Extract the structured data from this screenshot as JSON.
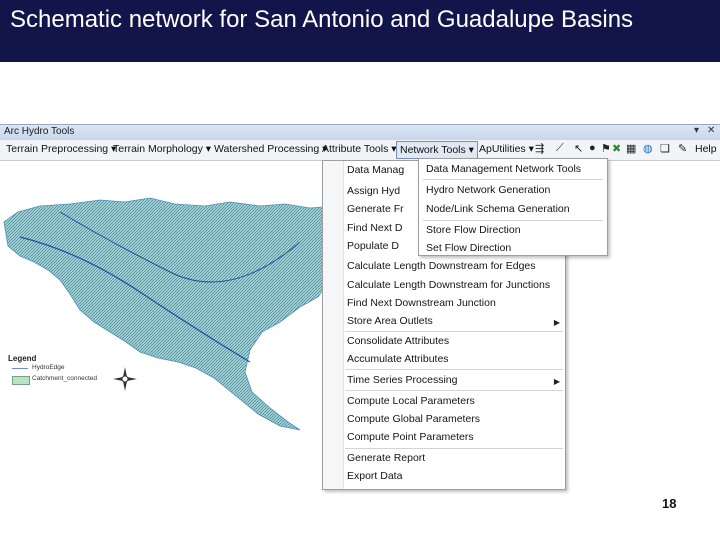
{
  "slide": {
    "title": "Schematic network for San Antonio and Guadalupe Basins",
    "page_number": "18",
    "colors": {
      "title_bar": "#12154a",
      "title_text": "#ffffff",
      "catchment_fill": "#a8d6c8",
      "stream_lines": "#2f6fb0"
    }
  },
  "toolbar": {
    "title": "Arc Hydro Tools",
    "window_controls": [
      "▾",
      "✕"
    ],
    "menus": [
      "Terrain Preprocessing ▾",
      "Terrain Morphology ▾",
      "Watershed Processing ▾",
      "Attribute Tools ▾",
      "Network Tools ▾",
      "ApUtilities ▾"
    ],
    "help_label": "Help",
    "icons": [
      "flow-icon",
      "wand-icon",
      "pointer-icon",
      "dot-icon",
      "flag-icon",
      "cross-icon",
      "grid-icon",
      "globe-icon",
      "layers-icon",
      "pencil-icon"
    ]
  },
  "attribute_menu": {
    "items_truncated": [
      "Data Manag",
      "Assign Hyd",
      "Generate Fr",
      "Find Next D",
      "Populate D"
    ],
    "items": [
      "Calculate Length Downstream for Edges",
      "Calculate Length Downstream for Junctions",
      "Find Next Downstream Junction",
      "Store Area Outlets",
      "Consolidate Attributes",
      "Accumulate Attributes",
      "Time Series Processing",
      "Compute Local Parameters",
      "Compute Global Parameters",
      "Compute Point Parameters",
      "Generate Report",
      "Export Data"
    ]
  },
  "network_menu": {
    "items": [
      "Data Management Network Tools",
      "Hydro Network Generation",
      "Node/Link Schema Generation",
      "Store Flow Direction",
      "Set Flow Direction"
    ]
  },
  "legend": {
    "title": "Legend",
    "items": [
      "HydroEdge",
      "Catchment_connected"
    ]
  }
}
